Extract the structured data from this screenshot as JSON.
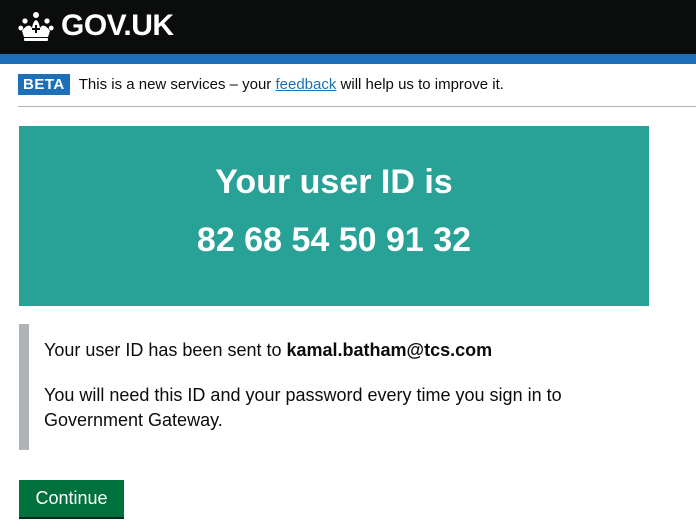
{
  "header": {
    "logo_text": "GOV.UK",
    "logo_icon": "crown-icon"
  },
  "phase_banner": {
    "tag": "BETA",
    "text_before": "This is a new services – your ",
    "link": "feedback",
    "text_after": " will help us to improve it."
  },
  "panel": {
    "title": "Your user ID is",
    "user_id": "82 68 54 50 91 32"
  },
  "inset": {
    "sent_prefix": "Your user ID has been sent to ",
    "email": "kamal.batham@tcs.com",
    "note": "You will need this ID and your password every time you sign in to Government Gateway."
  },
  "actions": {
    "continue_label": "Continue"
  },
  "colors": {
    "header_bg": "#0b0c0c",
    "brand_blue": "#1d70b8",
    "panel_green": "#28a197",
    "button_green": "#00703c",
    "inset_border": "#b1b4b6"
  }
}
